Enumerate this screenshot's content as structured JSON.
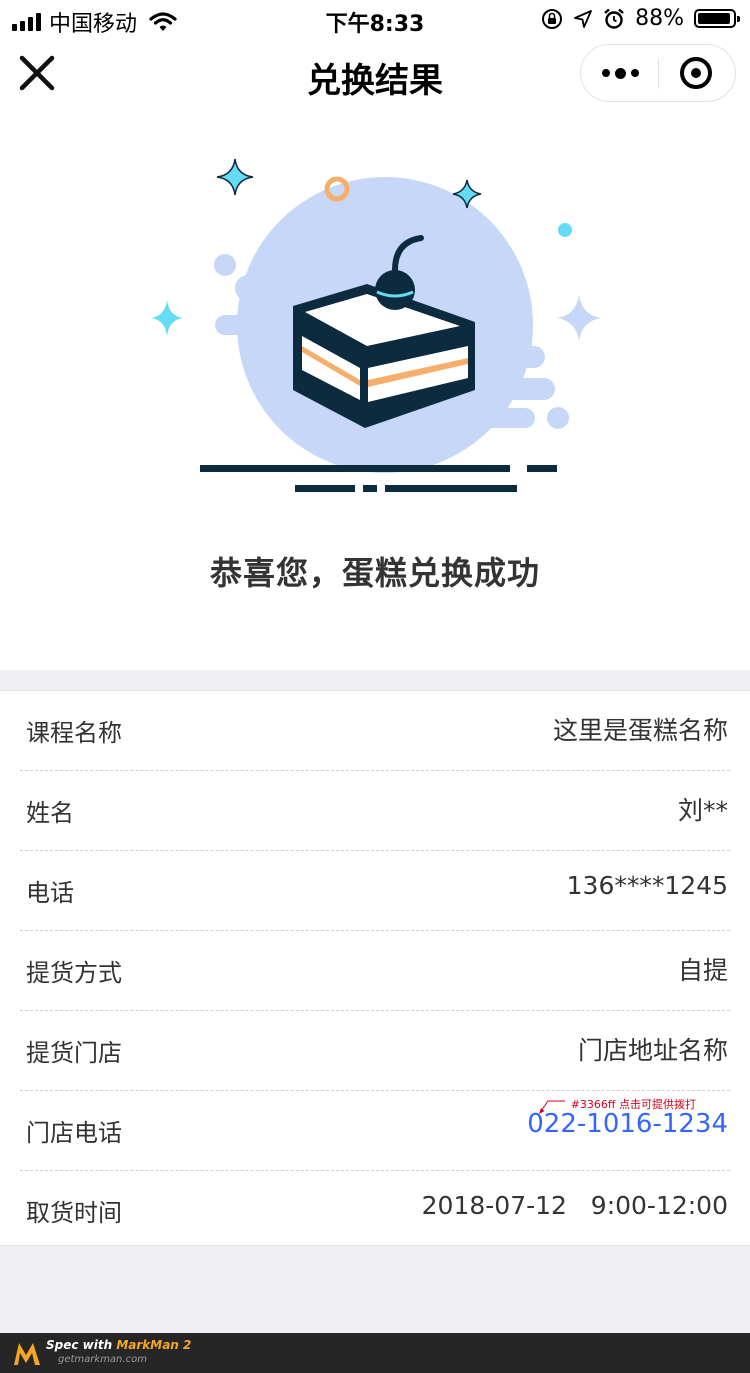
{
  "status_bar": {
    "carrier": "中国移动",
    "time": "下午8:33",
    "battery": "88%"
  },
  "nav": {
    "title": "兑换结果"
  },
  "result": {
    "message": "恭喜您，蛋糕兑换成功"
  },
  "details": [
    {
      "label": "课程名称",
      "value": "这里是蛋糕名称"
    },
    {
      "label": "姓名",
      "value": "刘**"
    },
    {
      "label": "电话",
      "value": "136****1245"
    },
    {
      "label": "提货方式",
      "value": "自提"
    },
    {
      "label": "提货门店",
      "value": "门店地址名称"
    },
    {
      "label": "门店电话",
      "value": "022-1016-1234"
    },
    {
      "label": "取货时间",
      "value": "2018-07-12   9:00-12:00"
    }
  ],
  "annotation": {
    "text": "#3366ff 点击可提供拨打"
  },
  "footer": {
    "spec_prefix": "Spec with ",
    "brand": "MarkMan 2",
    "site": "getmarkman.com"
  },
  "colors": {
    "phone_link": "#3366ff",
    "cake_dark": "#0d2b3e",
    "cake_stripe": "#f6ae6a",
    "blob": "#c6d7f8",
    "sparkle": "#64dcf5"
  }
}
